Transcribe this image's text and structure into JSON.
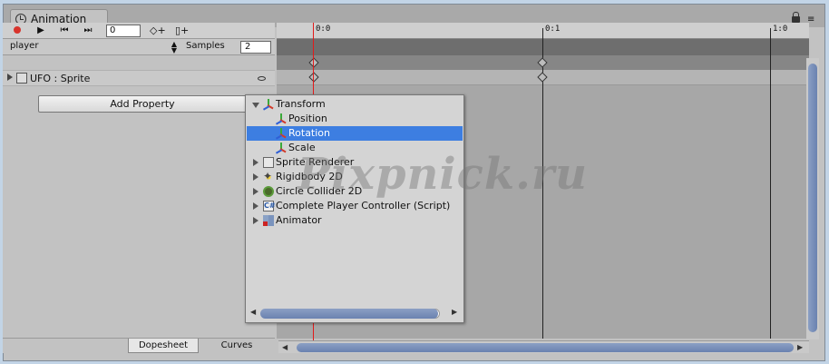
{
  "window": {
    "tab_title": "Animation",
    "menu_glyph": "≡"
  },
  "toolbar": {
    "frame_value": "0",
    "play_glyph": "▶",
    "prev_glyph": "⏮",
    "next_glyph": "⏭",
    "add_keyframe_glyph": "◇+",
    "add_event_glyph": "▯+"
  },
  "clip": {
    "selected": "player",
    "samples_label": "Samples",
    "samples_value": "2"
  },
  "properties": {
    "row_label": "UFO : Sprite",
    "add_property_label": "Add Property"
  },
  "ruler": {
    "labels": [
      "0:0",
      "0:1",
      "1:0"
    ]
  },
  "popup": {
    "items": [
      {
        "label": "Transform",
        "icon": "transform-icon",
        "expanded": true
      },
      {
        "label": "Position",
        "icon": "transform-icon"
      },
      {
        "label": "Rotation",
        "icon": "transform-icon",
        "selected": true
      },
      {
        "label": "Scale",
        "icon": "transform-icon"
      },
      {
        "label": "Sprite Renderer",
        "icon": "sprite-renderer-icon"
      },
      {
        "label": "Rigidbody 2D",
        "icon": "rigidbody-icon"
      },
      {
        "label": "Circle Collider 2D",
        "icon": "circle-collider-icon"
      },
      {
        "label": "Complete Player Controller (Script)",
        "icon": "script-icon"
      },
      {
        "label": "Animator",
        "icon": "animator-icon"
      }
    ],
    "script_icon_glyph": "C#"
  },
  "bottom_tabs": {
    "dopesheet": "Dopesheet",
    "curves": "Curves"
  },
  "watermark": "Pixpnick.ru",
  "colors": {
    "playhead": "#e21a1a",
    "selection": "#3d7ee1",
    "record": "#d8342c"
  }
}
